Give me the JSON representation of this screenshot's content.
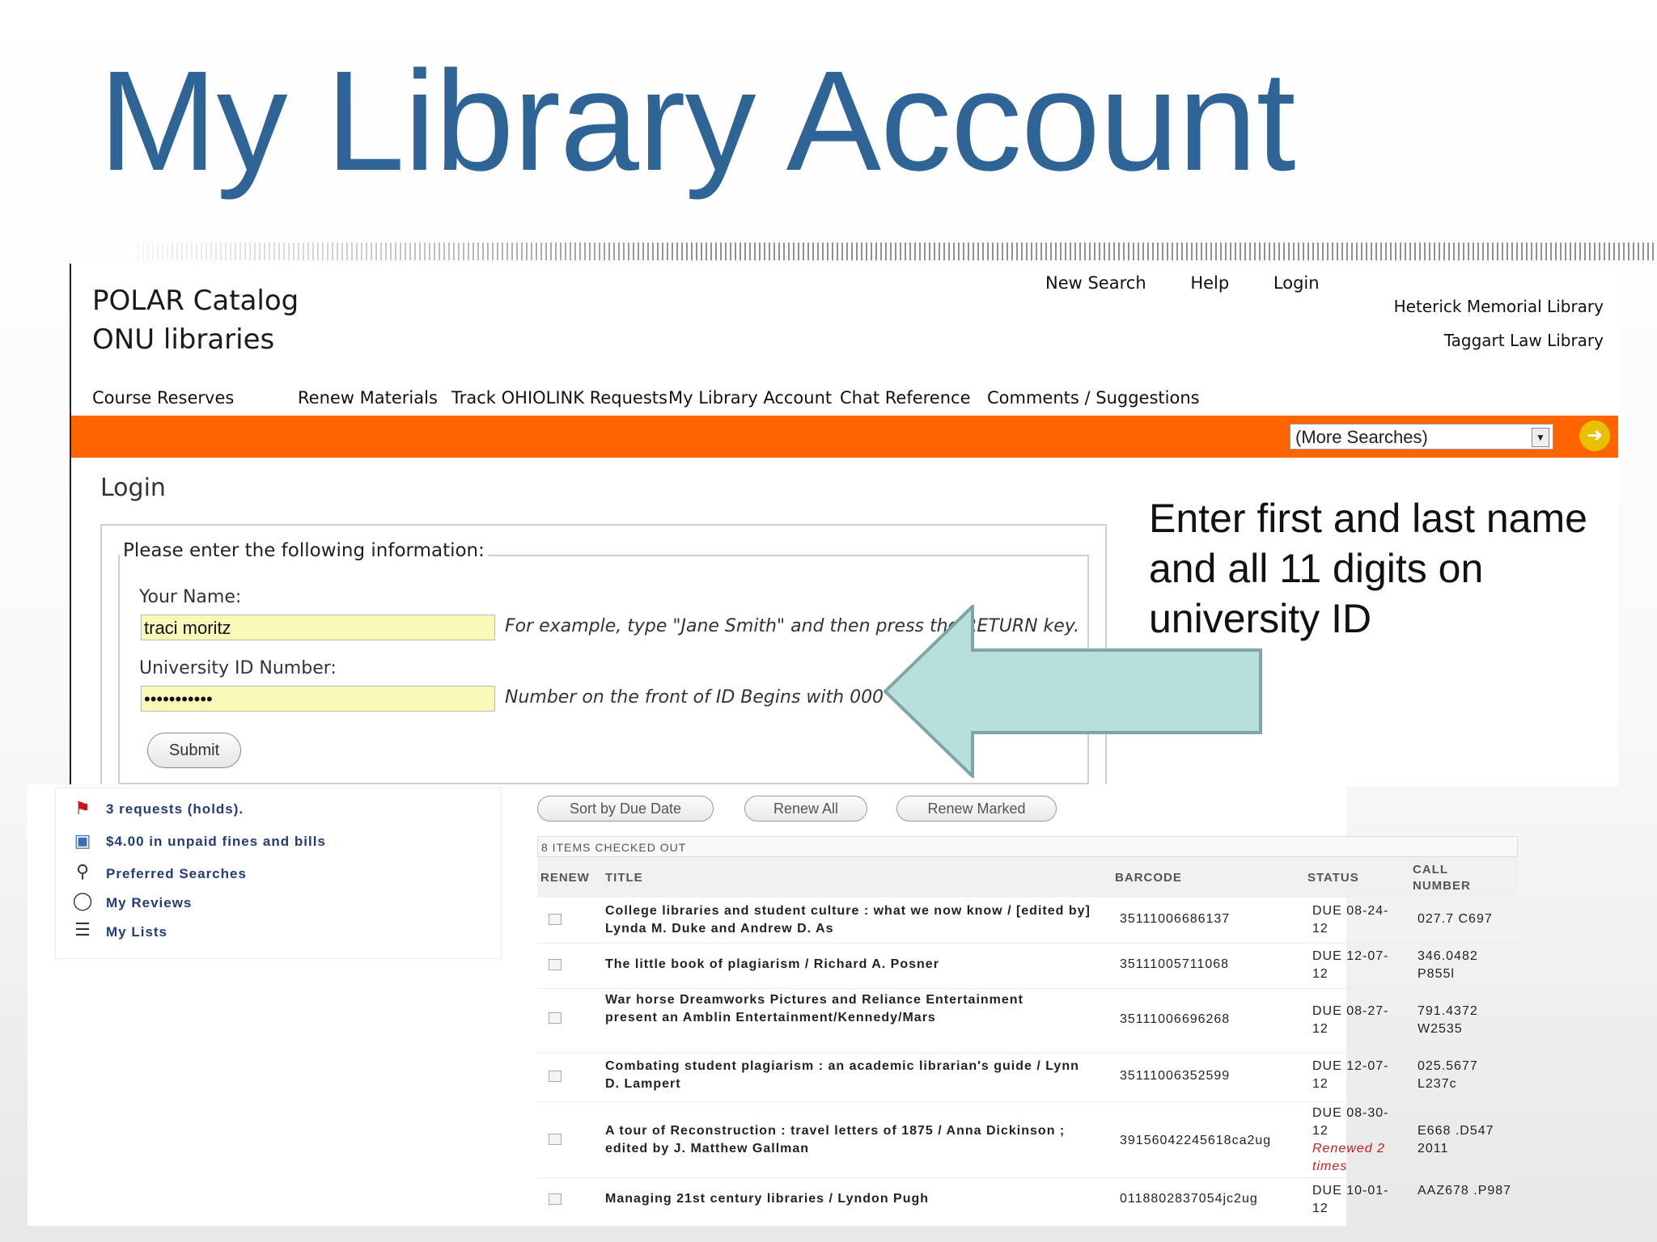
{
  "slide": {
    "title": "My Library Account"
  },
  "catalog": {
    "brand_line1": "POLAR Catalog",
    "brand_line2": "ONU libraries",
    "top_links": [
      "New Search",
      "Help",
      "Login"
    ],
    "libraries": [
      "Heterick Memorial Library",
      "Taggart Law Library"
    ],
    "nav": [
      "Course Reserves",
      "Renew Materials",
      "Track OHIOLINK Requests",
      "My Library Account",
      "Chat Reference",
      "Comments / Suggestions"
    ],
    "more_searches": "(More Searches)",
    "accent_color": "#ff6400"
  },
  "login": {
    "heading": "Login",
    "legend": "Please enter the following information:",
    "name_label": "Your Name:",
    "name_value": "traci moritz",
    "name_hint": "For example, type \"Jane Smith\" and then press the RETURN key.",
    "id_label": "University ID Number:",
    "id_value": "•••••••••••",
    "id_hint": "Number on the front of ID Begins with 000",
    "submit": "Submit"
  },
  "callout": {
    "text": "Enter first and last name and all 11 digits on university ID"
  },
  "account": {
    "side_items": [
      {
        "icon": "flag-icon",
        "label": "3 requests (holds)."
      },
      {
        "icon": "money-icon",
        "label": "$4.00 in unpaid fines and bills"
      },
      {
        "icon": "magnifier-icon",
        "label": "Preferred Searches"
      },
      {
        "icon": "speech-bubble-icon",
        "label": "My Reviews"
      },
      {
        "icon": "list-icon",
        "label": "My Lists"
      }
    ],
    "buttons": [
      "Sort by Due Date",
      "Renew All",
      "Renew Marked"
    ],
    "items_header": "8 ITEMS CHECKED OUT",
    "columns": [
      "RENEW",
      "TITLE",
      "BARCODE",
      "STATUS",
      "CALL NUMBER"
    ],
    "rows": [
      {
        "title": "College libraries and student culture : what we now know / [edited by] Lynda M. Duke and Andrew D. As",
        "barcode": "35111006686137",
        "status": "DUE 08-24-12",
        "call": "027.7 C697",
        "note": ""
      },
      {
        "title": "The little book of plagiarism / Richard A. Posner",
        "barcode": "35111005711068",
        "status": "DUE 12-07-12",
        "call": "346.0482 P855l",
        "note": ""
      },
      {
        "title": "War horse Dreamworks Pictures and Reliance Entertainment present an Amblin Entertainment/Kennedy/Mars",
        "barcode": "35111006696268",
        "status": "DUE 08-27-12",
        "call": "791.4372 W2535",
        "note": ""
      },
      {
        "title": "Combating student plagiarism : an academic librarian's guide / Lynn D. Lampert",
        "barcode": "35111006352599",
        "status": "DUE 12-07-12",
        "call": "025.5677 L237c",
        "note": ""
      },
      {
        "title": "A tour of Reconstruction : travel letters of 1875 / Anna Dickinson ; edited by J. Matthew Gallman",
        "barcode": "39156042245618ca2ug",
        "status": "DUE 08-30-12",
        "call": "E668 .D547 2011",
        "note": "Renewed 2 times"
      },
      {
        "title": "Managing 21st century libraries / Lyndon Pugh",
        "barcode": "0118802837054jc2ug",
        "status": "DUE 10-01-12",
        "call": "AAZ678 .P987",
        "note": ""
      }
    ]
  }
}
